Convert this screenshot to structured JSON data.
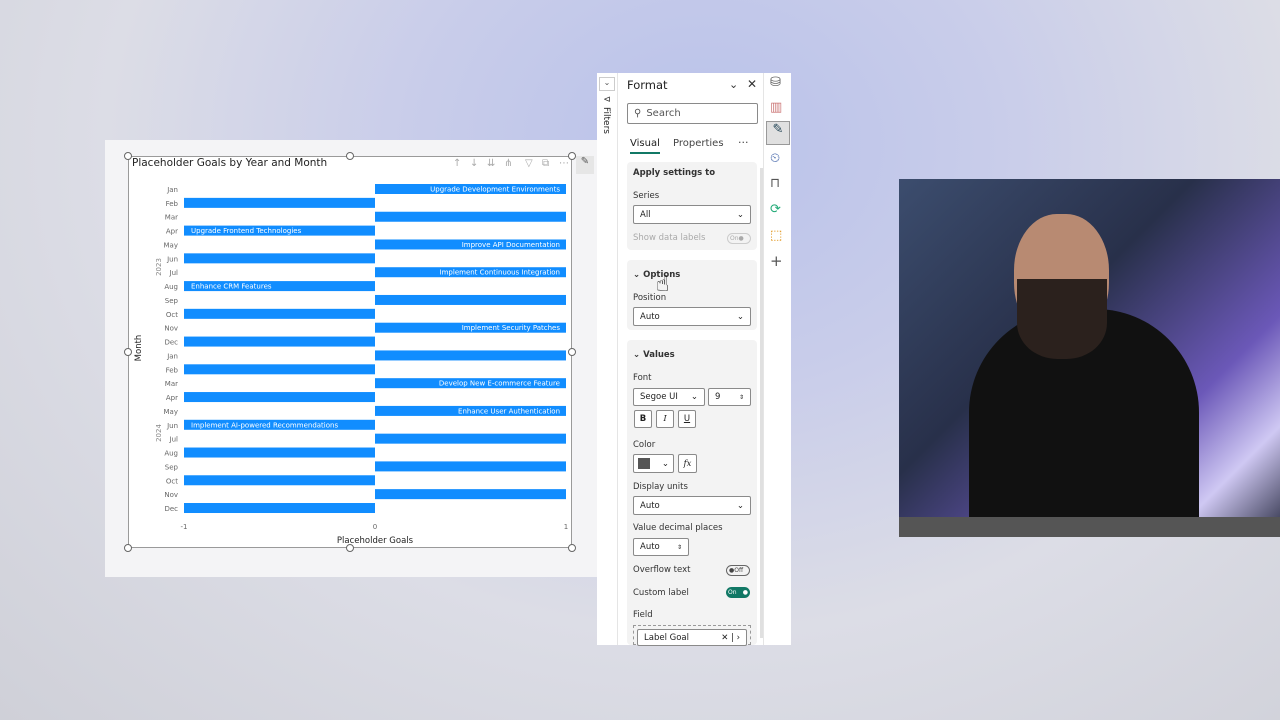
{
  "chart_data": {
    "type": "bar",
    "orientation": "horizontal",
    "title": "Placeholder Goals by Year and Month",
    "xlabel": "Placeholder Goals",
    "ylabel": "Month",
    "xlim": [
      -1,
      1
    ],
    "xticks": [
      "-1",
      "0",
      "1"
    ],
    "groups": [
      "2023",
      "2024"
    ],
    "categories": [
      "Jan",
      "Feb",
      "Mar",
      "Apr",
      "May",
      "Jun",
      "Jul",
      "Aug",
      "Sep",
      "Oct",
      "Nov",
      "Dec",
      "Jan",
      "Feb",
      "Mar",
      "Apr",
      "May",
      "Jun",
      "Jul",
      "Aug",
      "Sep",
      "Oct",
      "Nov",
      "Dec"
    ],
    "values": [
      1,
      -1,
      1,
      -1,
      1,
      -1,
      1,
      -1,
      1,
      -1,
      1,
      -1,
      1,
      -1,
      1,
      -1,
      1,
      -1,
      1,
      -1,
      1,
      -1,
      1,
      -1
    ],
    "labels": [
      "Upgrade Development Environments",
      "",
      "",
      "Upgrade Frontend Technologies",
      "Improve API Documentation",
      "",
      "Implement Continuous Integration",
      "Enhance CRM Features",
      "",
      "",
      "Implement Security Patches",
      "",
      "",
      "",
      "Develop New E-commerce Feature",
      "",
      "Enhance User Authentication",
      "Implement AI-powered Recommendations",
      "",
      "",
      "",
      "",
      "",
      ""
    ],
    "bar_color": "#118dff",
    "grid": false
  },
  "filters": {
    "label": "Filters"
  },
  "format": {
    "title": "Format",
    "search_placeholder": "Search",
    "tabs": [
      "Visual",
      "Properties"
    ],
    "more": "···",
    "apply": {
      "heading": "Apply settings to",
      "series_label": "Series",
      "series_value": "All",
      "show_labels": "Show data labels",
      "show_labels_toggle": "On"
    },
    "options": {
      "heading": "Options",
      "position_label": "Position",
      "position_value": "Auto"
    },
    "values": {
      "heading": "Values",
      "font_label": "Font",
      "font_value": "Segoe UI",
      "size_value": "9",
      "bold": "B",
      "italic": "I",
      "underline": "U",
      "color_label": "Color",
      "color_value": "#555555",
      "fx": "fx",
      "units_label": "Display units",
      "units_value": "Auto",
      "decimals_label": "Value decimal places",
      "decimals_value": "Auto",
      "overflow_label": "Overflow text",
      "overflow_toggle": "Off",
      "custom_label": "Custom label",
      "custom_toggle": "On",
      "field_label": "Field",
      "field_value": "Label Goal"
    },
    "accent": "#117865"
  }
}
